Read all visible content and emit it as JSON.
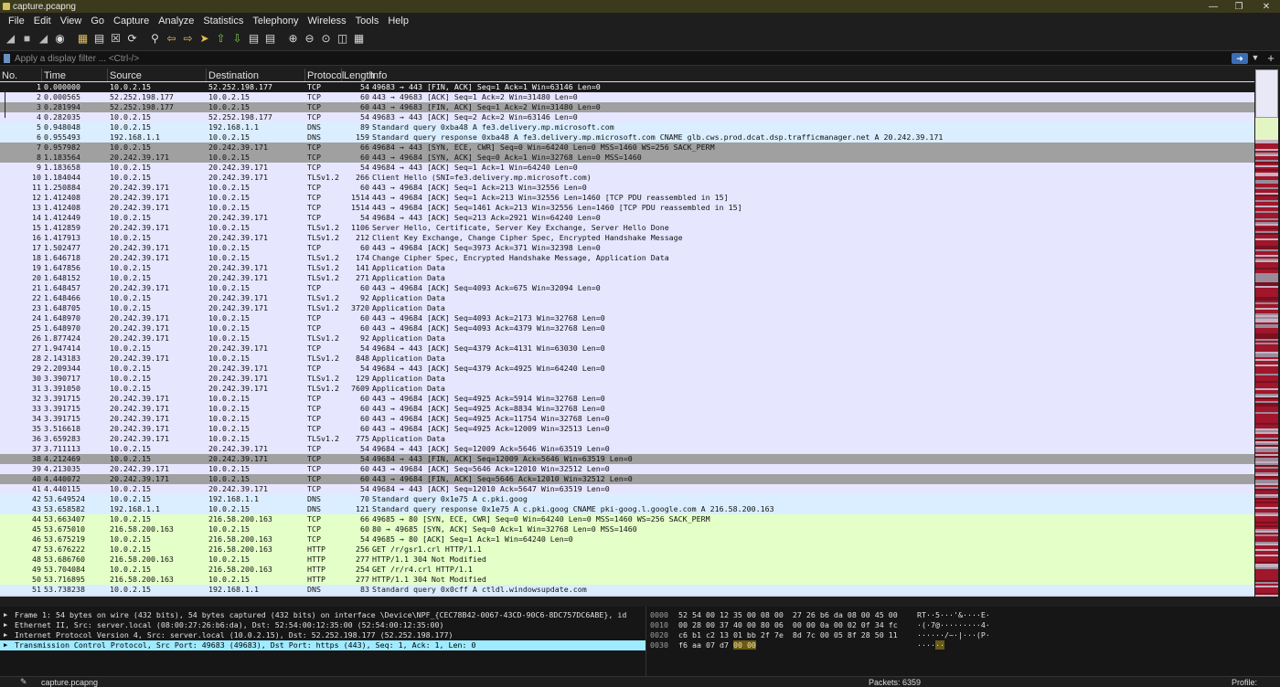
{
  "window": {
    "title": "capture.pcapng"
  },
  "menu": [
    "File",
    "Edit",
    "View",
    "Go",
    "Capture",
    "Analyze",
    "Statistics",
    "Telephony",
    "Wireless",
    "Tools",
    "Help"
  ],
  "filter": {
    "placeholder": "Apply a display filter ... <Ctrl-/>"
  },
  "columns": [
    "No.",
    "Time",
    "Source",
    "Destination",
    "Protocol",
    "Length",
    "Info"
  ],
  "colors": {
    "tcp": "#e7e6ff",
    "udp": "#daeeff",
    "http": "#e4ffc7",
    "bad": "#a0a0a0",
    "selected": "#1b1b1b",
    "detail_selected": "#9eeaff"
  },
  "packets": [
    {
      "no": "1",
      "time": "0.000000",
      "src": "10.0.2.15",
      "dst": "52.252.198.177",
      "proto": "TCP",
      "len": "54",
      "info": "49683 → 443 [FIN, ACK] Seq=1 Ack=1 Win=63146 Len=0",
      "style": "selected"
    },
    {
      "no": "2",
      "time": "0.000565",
      "src": "52.252.198.177",
      "dst": "10.0.2.15",
      "proto": "TCP",
      "len": "60",
      "info": "443 → 49683 [ACK] Seq=1 Ack=2 Win=31480 Len=0",
      "style": "tcp"
    },
    {
      "no": "3",
      "time": "0.281994",
      "src": "52.252.198.177",
      "dst": "10.0.2.15",
      "proto": "TCP",
      "len": "60",
      "info": "443 → 49683 [FIN, ACK] Seq=1 Ack=2 Win=31480 Len=0",
      "style": "bad"
    },
    {
      "no": "4",
      "time": "0.282035",
      "src": "10.0.2.15",
      "dst": "52.252.198.177",
      "proto": "TCP",
      "len": "54",
      "info": "49683 → 443 [ACK] Seq=2 Ack=2 Win=63146 Len=0",
      "style": "tcp"
    },
    {
      "no": "5",
      "time": "0.948048",
      "src": "10.0.2.15",
      "dst": "192.168.1.1",
      "proto": "DNS",
      "len": "89",
      "info": "Standard query 0xba48 A fe3.delivery.mp.microsoft.com",
      "style": "udp"
    },
    {
      "no": "6",
      "time": "0.955493",
      "src": "192.168.1.1",
      "dst": "10.0.2.15",
      "proto": "DNS",
      "len": "159",
      "info": "Standard query response 0xba48 A fe3.delivery.mp.microsoft.com CNAME glb.cws.prod.dcat.dsp.trafficmanager.net A 20.242.39.171",
      "style": "udp"
    },
    {
      "no": "7",
      "time": "0.957982",
      "src": "10.0.2.15",
      "dst": "20.242.39.171",
      "proto": "TCP",
      "len": "66",
      "info": "49684 → 443 [SYN, ECE, CWR] Seq=0 Win=64240 Len=0 MSS=1460 WS=256 SACK_PERM",
      "style": "bad"
    },
    {
      "no": "8",
      "time": "1.183564",
      "src": "20.242.39.171",
      "dst": "10.0.2.15",
      "proto": "TCP",
      "len": "60",
      "info": "443 → 49684 [SYN, ACK] Seq=0 Ack=1 Win=32768 Len=0 MSS=1460",
      "style": "bad"
    },
    {
      "no": "9",
      "time": "1.183658",
      "src": "10.0.2.15",
      "dst": "20.242.39.171",
      "proto": "TCP",
      "len": "54",
      "info": "49684 → 443 [ACK] Seq=1 Ack=1 Win=64240 Len=0",
      "style": "tcp"
    },
    {
      "no": "10",
      "time": "1.184044",
      "src": "10.0.2.15",
      "dst": "20.242.39.171",
      "proto": "TLSv1.2",
      "len": "266",
      "info": "Client Hello (SNI=fe3.delivery.mp.microsoft.com)",
      "style": "tcp"
    },
    {
      "no": "11",
      "time": "1.250884",
      "src": "20.242.39.171",
      "dst": "10.0.2.15",
      "proto": "TCP",
      "len": "60",
      "info": "443 → 49684 [ACK] Seq=1 Ack=213 Win=32556 Len=0",
      "style": "tcp"
    },
    {
      "no": "12",
      "time": "1.412408",
      "src": "20.242.39.171",
      "dst": "10.0.2.15",
      "proto": "TCP",
      "len": "1514",
      "info": "443 → 49684 [ACK] Seq=1 Ack=213 Win=32556 Len=1460 [TCP PDU reassembled in 15]",
      "style": "tcp"
    },
    {
      "no": "13",
      "time": "1.412408",
      "src": "20.242.39.171",
      "dst": "10.0.2.15",
      "proto": "TCP",
      "len": "1514",
      "info": "443 → 49684 [ACK] Seq=1461 Ack=213 Win=32556 Len=1460 [TCP PDU reassembled in 15]",
      "style": "tcp"
    },
    {
      "no": "14",
      "time": "1.412449",
      "src": "10.0.2.15",
      "dst": "20.242.39.171",
      "proto": "TCP",
      "len": "54",
      "info": "49684 → 443 [ACK] Seq=213 Ack=2921 Win=64240 Len=0",
      "style": "tcp"
    },
    {
      "no": "15",
      "time": "1.412859",
      "src": "20.242.39.171",
      "dst": "10.0.2.15",
      "proto": "TLSv1.2",
      "len": "1106",
      "info": "Server Hello, Certificate, Server Key Exchange, Server Hello Done",
      "style": "tcp"
    },
    {
      "no": "16",
      "time": "1.417913",
      "src": "10.0.2.15",
      "dst": "20.242.39.171",
      "proto": "TLSv1.2",
      "len": "212",
      "info": "Client Key Exchange, Change Cipher Spec, Encrypted Handshake Message",
      "style": "tcp"
    },
    {
      "no": "17",
      "time": "1.502477",
      "src": "20.242.39.171",
      "dst": "10.0.2.15",
      "proto": "TCP",
      "len": "60",
      "info": "443 → 49684 [ACK] Seq=3973 Ack=371 Win=32398 Len=0",
      "style": "tcp"
    },
    {
      "no": "18",
      "time": "1.646718",
      "src": "20.242.39.171",
      "dst": "10.0.2.15",
      "proto": "TLSv1.2",
      "len": "174",
      "info": "Change Cipher Spec, Encrypted Handshake Message, Application Data",
      "style": "tcp"
    },
    {
      "no": "19",
      "time": "1.647856",
      "src": "10.0.2.15",
      "dst": "20.242.39.171",
      "proto": "TLSv1.2",
      "len": "141",
      "info": "Application Data",
      "style": "tcp"
    },
    {
      "no": "20",
      "time": "1.648152",
      "src": "10.0.2.15",
      "dst": "20.242.39.171",
      "proto": "TLSv1.2",
      "len": "271",
      "info": "Application Data",
      "style": "tcp"
    },
    {
      "no": "21",
      "time": "1.648457",
      "src": "20.242.39.171",
      "dst": "10.0.2.15",
      "proto": "TCP",
      "len": "60",
      "info": "443 → 49684 [ACK] Seq=4093 Ack=675 Win=32094 Len=0",
      "style": "tcp"
    },
    {
      "no": "22",
      "time": "1.648466",
      "src": "10.0.2.15",
      "dst": "20.242.39.171",
      "proto": "TLSv1.2",
      "len": "92",
      "info": "Application Data",
      "style": "tcp"
    },
    {
      "no": "23",
      "time": "1.648705",
      "src": "10.0.2.15",
      "dst": "20.242.39.171",
      "proto": "TLSv1.2",
      "len": "3720",
      "info": "Application Data",
      "style": "tcp"
    },
    {
      "no": "24",
      "time": "1.648970",
      "src": "20.242.39.171",
      "dst": "10.0.2.15",
      "proto": "TCP",
      "len": "60",
      "info": "443 → 49684 [ACK] Seq=4093 Ack=2173 Win=32768 Len=0",
      "style": "tcp"
    },
    {
      "no": "25",
      "time": "1.648970",
      "src": "20.242.39.171",
      "dst": "10.0.2.15",
      "proto": "TCP",
      "len": "60",
      "info": "443 → 49684 [ACK] Seq=4093 Ack=4379 Win=32768 Len=0",
      "style": "tcp"
    },
    {
      "no": "26",
      "time": "1.877424",
      "src": "20.242.39.171",
      "dst": "10.0.2.15",
      "proto": "TLSv1.2",
      "len": "92",
      "info": "Application Data",
      "style": "tcp"
    },
    {
      "no": "27",
      "time": "1.947414",
      "src": "10.0.2.15",
      "dst": "20.242.39.171",
      "proto": "TCP",
      "len": "54",
      "info": "49684 → 443 [ACK] Seq=4379 Ack=4131 Win=63030 Len=0",
      "style": "tcp"
    },
    {
      "no": "28",
      "time": "2.143183",
      "src": "20.242.39.171",
      "dst": "10.0.2.15",
      "proto": "TLSv1.2",
      "len": "848",
      "info": "Application Data",
      "style": "tcp"
    },
    {
      "no": "29",
      "time": "2.209344",
      "src": "10.0.2.15",
      "dst": "20.242.39.171",
      "proto": "TCP",
      "len": "54",
      "info": "49684 → 443 [ACK] Seq=4379 Ack=4925 Win=64240 Len=0",
      "style": "tcp"
    },
    {
      "no": "30",
      "time": "3.390717",
      "src": "10.0.2.15",
      "dst": "20.242.39.171",
      "proto": "TLSv1.2",
      "len": "129",
      "info": "Application Data",
      "style": "tcp"
    },
    {
      "no": "31",
      "time": "3.391050",
      "src": "10.0.2.15",
      "dst": "20.242.39.171",
      "proto": "TLSv1.2",
      "len": "7609",
      "info": "Application Data",
      "style": "tcp"
    },
    {
      "no": "32",
      "time": "3.391715",
      "src": "20.242.39.171",
      "dst": "10.0.2.15",
      "proto": "TCP",
      "len": "60",
      "info": "443 → 49684 [ACK] Seq=4925 Ack=5914 Win=32768 Len=0",
      "style": "tcp"
    },
    {
      "no": "33",
      "time": "3.391715",
      "src": "20.242.39.171",
      "dst": "10.0.2.15",
      "proto": "TCP",
      "len": "60",
      "info": "443 → 49684 [ACK] Seq=4925 Ack=8834 Win=32768 Len=0",
      "style": "tcp"
    },
    {
      "no": "34",
      "time": "3.391715",
      "src": "20.242.39.171",
      "dst": "10.0.2.15",
      "proto": "TCP",
      "len": "60",
      "info": "443 → 49684 [ACK] Seq=4925 Ack=11754 Win=32768 Len=0",
      "style": "tcp"
    },
    {
      "no": "35",
      "time": "3.516618",
      "src": "20.242.39.171",
      "dst": "10.0.2.15",
      "proto": "TCP",
      "len": "60",
      "info": "443 → 49684 [ACK] Seq=4925 Ack=12009 Win=32513 Len=0",
      "style": "tcp"
    },
    {
      "no": "36",
      "time": "3.659283",
      "src": "20.242.39.171",
      "dst": "10.0.2.15",
      "proto": "TLSv1.2",
      "len": "775",
      "info": "Application Data",
      "style": "tcp"
    },
    {
      "no": "37",
      "time": "3.711113",
      "src": "10.0.2.15",
      "dst": "20.242.39.171",
      "proto": "TCP",
      "len": "54",
      "info": "49684 → 443 [ACK] Seq=12009 Ack=5646 Win=63519 Len=0",
      "style": "tcp"
    },
    {
      "no": "38",
      "time": "4.212469",
      "src": "10.0.2.15",
      "dst": "20.242.39.171",
      "proto": "TCP",
      "len": "54",
      "info": "49684 → 443 [FIN, ACK] Seq=12009 Ack=5646 Win=63519 Len=0",
      "style": "bad"
    },
    {
      "no": "39",
      "time": "4.213035",
      "src": "20.242.39.171",
      "dst": "10.0.2.15",
      "proto": "TCP",
      "len": "60",
      "info": "443 → 49684 [ACK] Seq=5646 Ack=12010 Win=32512 Len=0",
      "style": "tcp"
    },
    {
      "no": "40",
      "time": "4.440072",
      "src": "20.242.39.171",
      "dst": "10.0.2.15",
      "proto": "TCP",
      "len": "60",
      "info": "443 → 49684 [FIN, ACK] Seq=5646 Ack=12010 Win=32512 Len=0",
      "style": "bad"
    },
    {
      "no": "41",
      "time": "4.440115",
      "src": "10.0.2.15",
      "dst": "20.242.39.171",
      "proto": "TCP",
      "len": "54",
      "info": "49684 → 443 [ACK] Seq=12010 Ack=5647 Win=63519 Len=0",
      "style": "tcp"
    },
    {
      "no": "42",
      "time": "53.649524",
      "src": "10.0.2.15",
      "dst": "192.168.1.1",
      "proto": "DNS",
      "len": "70",
      "info": "Standard query 0x1e75 A c.pki.goog",
      "style": "udp"
    },
    {
      "no": "43",
      "time": "53.658582",
      "src": "192.168.1.1",
      "dst": "10.0.2.15",
      "proto": "DNS",
      "len": "121",
      "info": "Standard query response 0x1e75 A c.pki.goog CNAME pki-goog.l.google.com A 216.58.200.163",
      "style": "udp"
    },
    {
      "no": "44",
      "time": "53.663407",
      "src": "10.0.2.15",
      "dst": "216.58.200.163",
      "proto": "TCP",
      "len": "66",
      "info": "49685 → 80 [SYN, ECE, CWR] Seq=0 Win=64240 Len=0 MSS=1460 WS=256 SACK_PERM",
      "style": "http"
    },
    {
      "no": "45",
      "time": "53.675010",
      "src": "216.58.200.163",
      "dst": "10.0.2.15",
      "proto": "TCP",
      "len": "60",
      "info": "80 → 49685 [SYN, ACK] Seq=0 Ack=1 Win=32768 Len=0 MSS=1460",
      "style": "http"
    },
    {
      "no": "46",
      "time": "53.675219",
      "src": "10.0.2.15",
      "dst": "216.58.200.163",
      "proto": "TCP",
      "len": "54",
      "info": "49685 → 80 [ACK] Seq=1 Ack=1 Win=64240 Len=0",
      "style": "http"
    },
    {
      "no": "47",
      "time": "53.676222",
      "src": "10.0.2.15",
      "dst": "216.58.200.163",
      "proto": "HTTP",
      "len": "256",
      "info": "GET /r/gsr1.crl HTTP/1.1",
      "style": "http"
    },
    {
      "no": "48",
      "time": "53.686760",
      "src": "216.58.200.163",
      "dst": "10.0.2.15",
      "proto": "HTTP",
      "len": "277",
      "info": "HTTP/1.1 304 Not Modified",
      "style": "http"
    },
    {
      "no": "49",
      "time": "53.704084",
      "src": "10.0.2.15",
      "dst": "216.58.200.163",
      "proto": "HTTP",
      "len": "254",
      "info": "GET /r/r4.crl HTTP/1.1",
      "style": "http"
    },
    {
      "no": "50",
      "time": "53.716895",
      "src": "216.58.200.163",
      "dst": "10.0.2.15",
      "proto": "HTTP",
      "len": "277",
      "info": "HTTP/1.1 304 Not Modified",
      "style": "http"
    },
    {
      "no": "51",
      "time": "53.738238",
      "src": "10.0.2.15",
      "dst": "192.168.1.1",
      "proto": "DNS",
      "len": "83",
      "info": "Standard query 0x0cff A ctldl.windowsupdate.com",
      "style": "udp"
    }
  ],
  "details": [
    {
      "text": "Frame 1: 54 bytes on wire (432 bits), 54 bytes captured (432 bits) on interface \\Device\\NPF_{CEC78B42-0067-43CD-90C6-8DC757DC6ABE}, id",
      "selected": false
    },
    {
      "text": "Ethernet II, Src: server.local (08:00:27:26:b6:da), Dst: 52:54:00:12:35:00 (52:54:00:12:35:00)",
      "selected": false
    },
    {
      "text": "Internet Protocol Version 4, Src: server.local (10.0.2.15), Dst: 52.252.198.177 (52.252.198.177)",
      "selected": false
    },
    {
      "text": "Transmission Control Protocol, Src Port: 49683 (49683), Dst Port: https (443), Seq: 1, Ack: 1, Len: 0",
      "selected": true
    }
  ],
  "hex": [
    {
      "offset": "0000",
      "bytes": "52 54 00 12 35 00 08 00  27 26 b6 da 08 00 45 00",
      "ascii": "RT··5···'&····E·"
    },
    {
      "offset": "0010",
      "bytes": "00 28 00 37 40 00 80 06  00 00 0a 00 02 0f 34 fc",
      "ascii": "·(·7@·········4·"
    },
    {
      "offset": "0020",
      "bytes": "c6 b1 c2 13 01 bb 2f 7e  8d 7c 00 05 8f 28 50 11",
      "ascii": "······/~·|···(P·"
    },
    {
      "offset": "0030",
      "bytes": "f6 aa 07 d7",
      "bytes_hl": "00 00",
      "ascii": "····",
      "ascii_hl": "··"
    }
  ],
  "status": {
    "file": "capture.pcapng",
    "packets": "Packets: 6359",
    "profile": "Profile: Default"
  }
}
